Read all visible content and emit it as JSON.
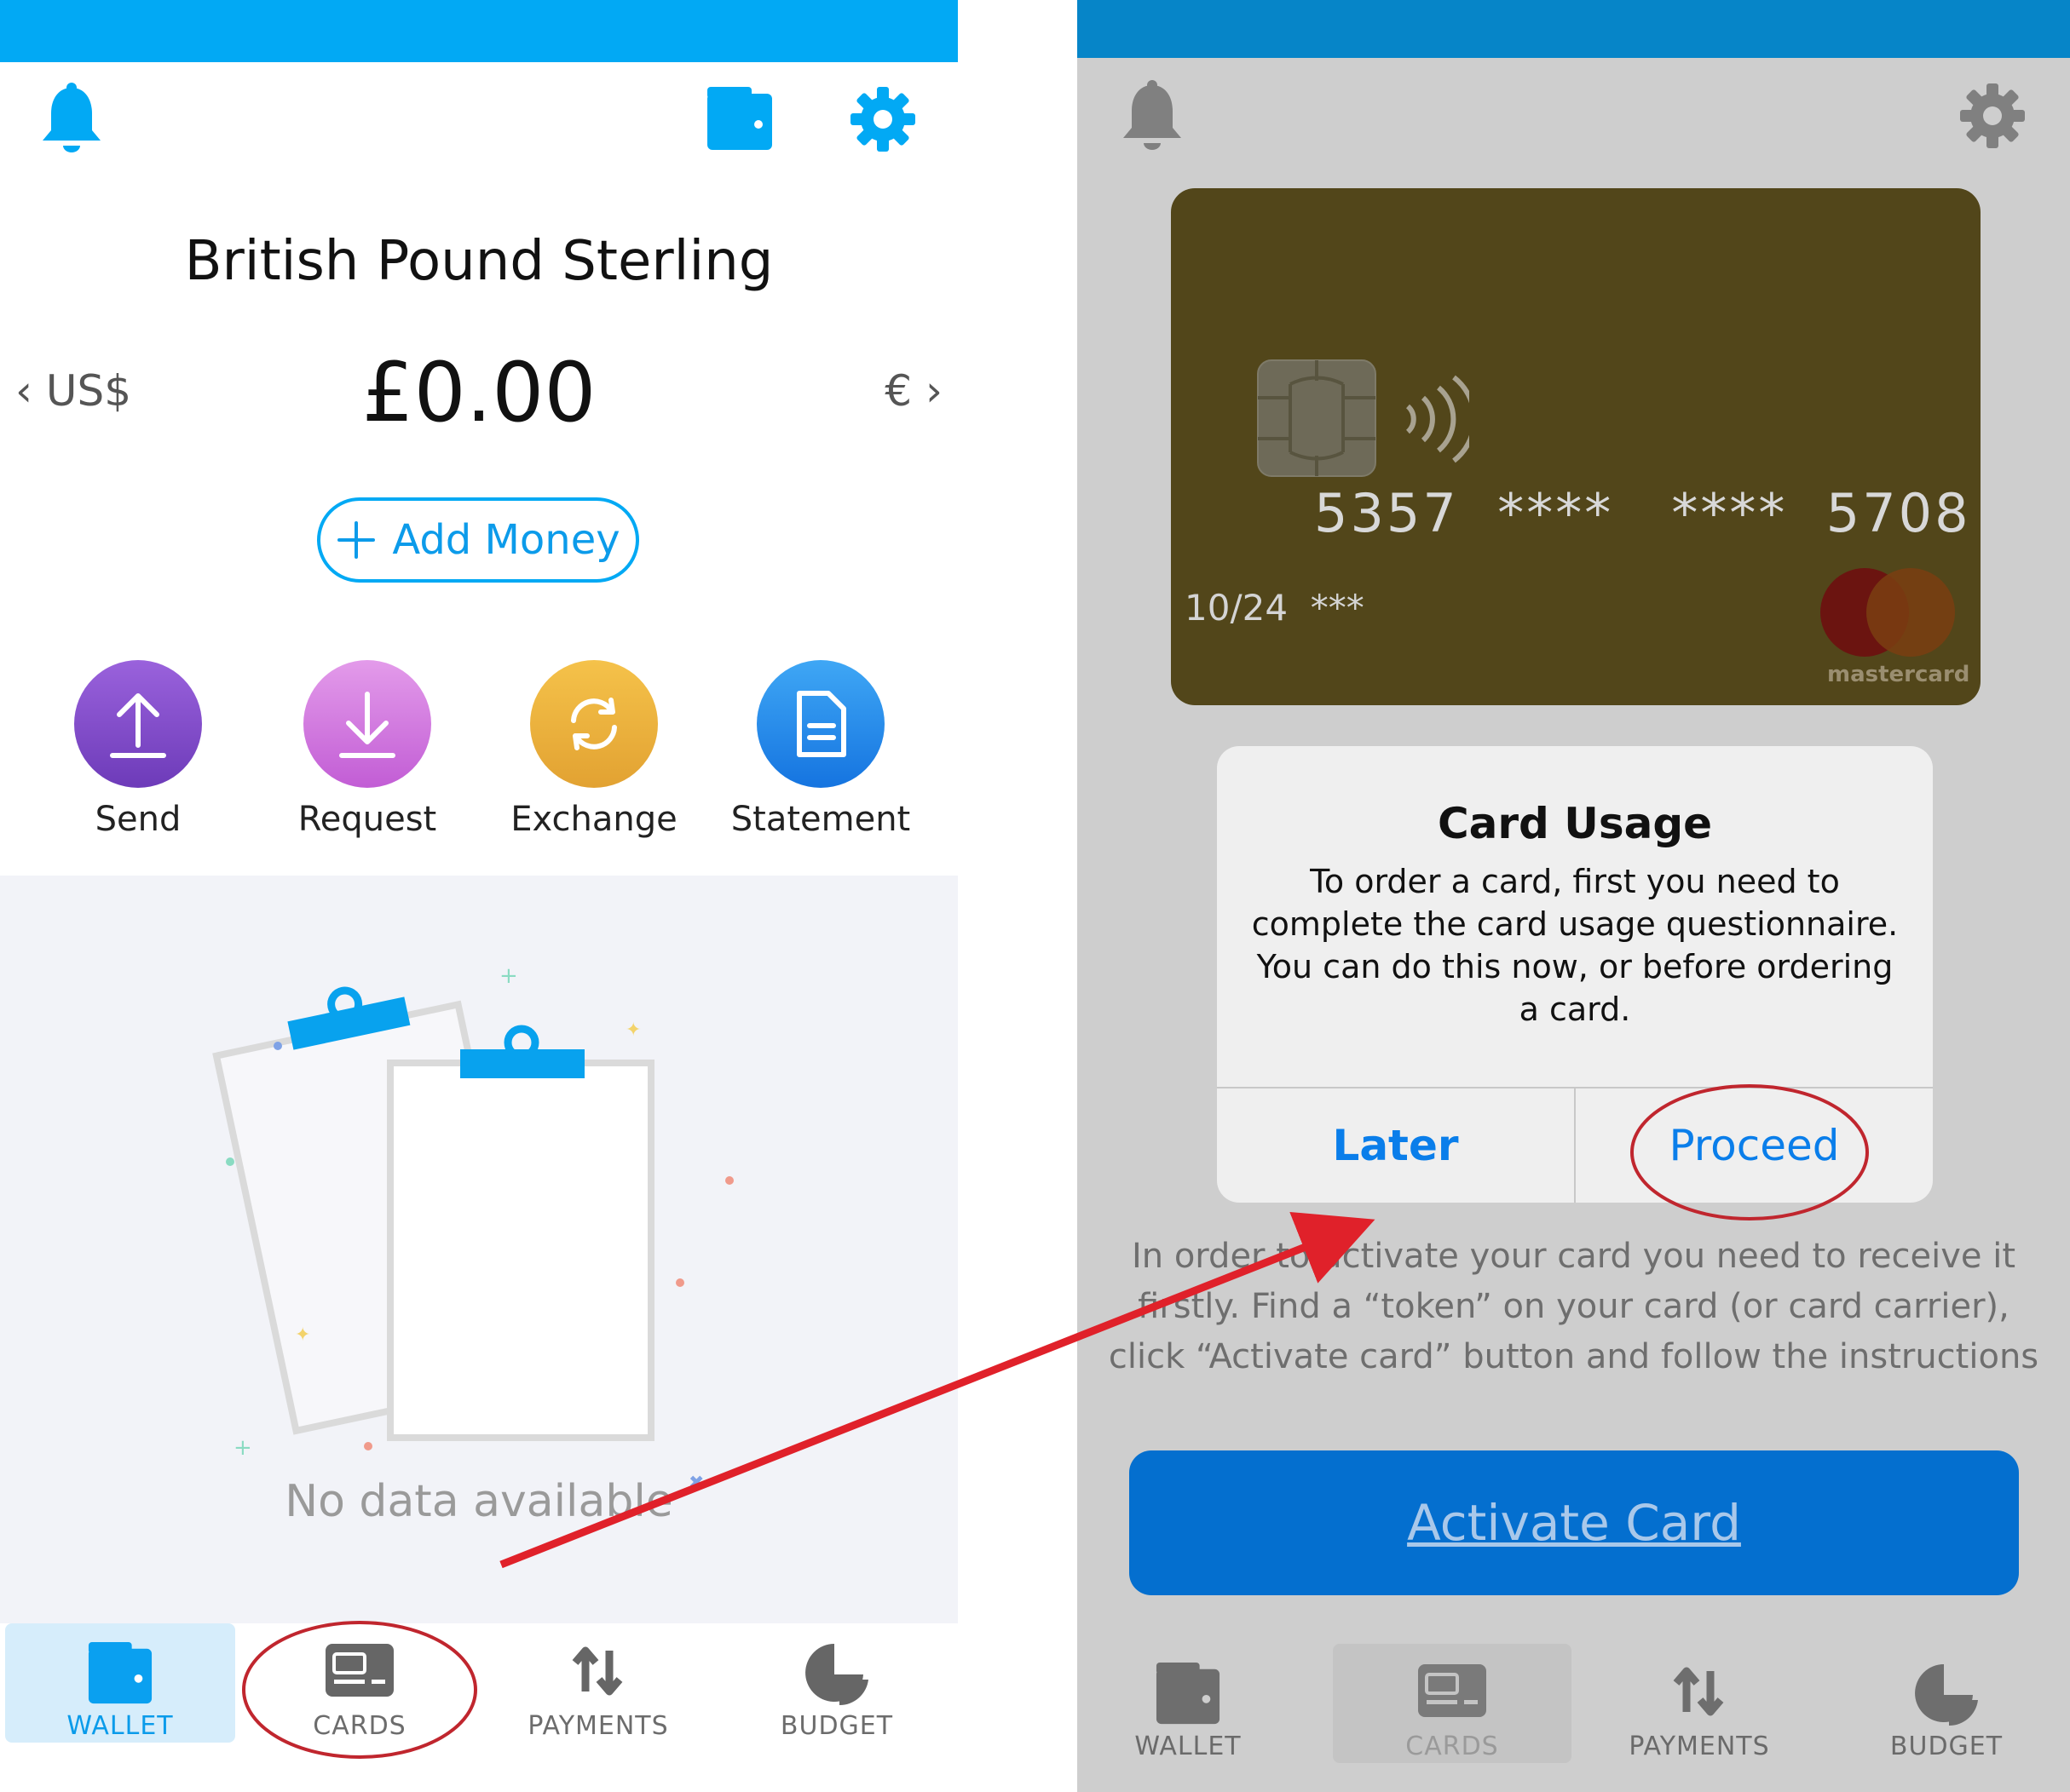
{
  "wallet_screen": {
    "title": "British Pound Sterling",
    "balance": "£0.00",
    "prev_currency": "US$",
    "next_currency": "€",
    "add_money_label": "Add Money",
    "actions": [
      {
        "label": "Send",
        "color": "#8A4FD0",
        "icon": "upload-arrow-icon"
      },
      {
        "label": "Request",
        "color": "#D77BE0",
        "icon": "download-arrow-icon"
      },
      {
        "label": "Exchange",
        "color": "#EDB43B",
        "icon": "refresh-icon"
      },
      {
        "label": "Statement",
        "color": "#1E8FEF",
        "icon": "document-icon"
      }
    ],
    "empty_state": "No data available",
    "tabs": [
      {
        "label": "WALLET",
        "icon": "wallet-icon",
        "active": true
      },
      {
        "label": "CARDS",
        "icon": "card-icon",
        "active": false
      },
      {
        "label": "PAYMENTS",
        "icon": "transfer-arrows-icon",
        "active": false
      },
      {
        "label": "BUDGET",
        "icon": "pie-chart-icon",
        "active": false
      }
    ]
  },
  "cards_screen": {
    "card": {
      "number": "5357  ****   ****  5708",
      "expiry_cvv": "10/24  ***",
      "brand": "mastercard",
      "color": "#52461A"
    },
    "dialog": {
      "title": "Card Usage",
      "message": "To order a card, first you need to complete the card usage questionnaire. You can do this now, or before ordering a card.",
      "later_label": "Later",
      "proceed_label": "Proceed"
    },
    "info_text": "In order to activate your card you need to receive it firstly. Find a “token” on your card (or card carrier), click “Activate card” button and follow the instructions",
    "activate_label": "Activate Card",
    "tabs": [
      {
        "label": "WALLET",
        "icon": "wallet-icon",
        "active": false
      },
      {
        "label": "CARDS",
        "icon": "card-icon",
        "active": true
      },
      {
        "label": "PAYMENTS",
        "icon": "transfer-arrows-icon",
        "active": false
      },
      {
        "label": "BUDGET",
        "icon": "pie-chart-icon",
        "active": false
      }
    ]
  },
  "colors": {
    "accent_blue": "#02A9F4",
    "annotation_red": "#E0212A"
  }
}
